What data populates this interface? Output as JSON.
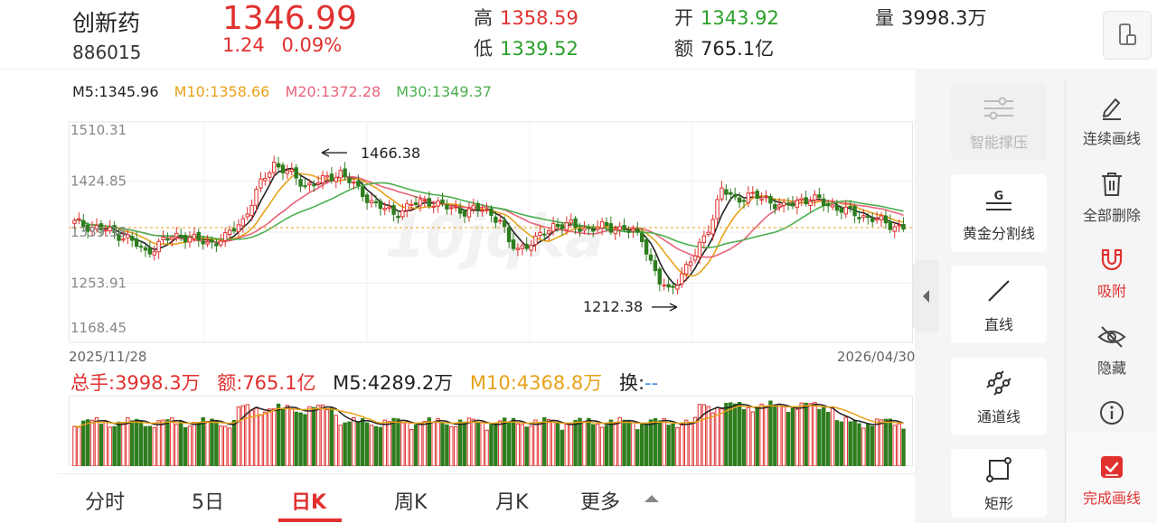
{
  "header": {
    "name": "创新药",
    "code": "886015",
    "price": "1346.99",
    "change": "1.24",
    "change_pct": "0.09%",
    "high_label": "高",
    "high": "1358.59",
    "low_label": "低",
    "low": "1339.52",
    "open_label": "开",
    "open": "1343.92",
    "amount_label": "额",
    "amount": "765.1亿",
    "volume_label": "量",
    "volume": "3998.3万"
  },
  "ma_legend": {
    "m5": "M5:1345.96",
    "m10": "M10:1358.66",
    "m20": "M20:1372.28",
    "m30": "M30:1349.37"
  },
  "volume_legend": {
    "total": "总手:3998.3万",
    "amount": "额:765.1亿",
    "m5": "M5:4289.2万",
    "m10": "M10:4368.8万",
    "turnover_label": "换:",
    "turnover_value": "--"
  },
  "chart_data": {
    "type": "candlestick",
    "y_ticks": [
      "1510.31",
      "1424.85",
      "1339.38",
      "1253.91",
      "1168.45"
    ],
    "ylim": [
      1168.45,
      1510.31
    ],
    "x_start": "2025/11/28",
    "x_end": "2026/04/30",
    "annotations": [
      {
        "text": "1466.38",
        "value": 1466.38
      },
      {
        "text": "1212.38",
        "value": 1212.38
      }
    ],
    "last_close": 1346.99,
    "colors": {
      "up": "#e0312f",
      "down": "#2e7d1e",
      "m5": "#222222",
      "m10": "#e8a21a",
      "m20": "#e8647a",
      "m30": "#4caf50"
    }
  },
  "tabs": [
    {
      "label": "分时",
      "active": false
    },
    {
      "label": "5日",
      "active": false
    },
    {
      "label": "日K",
      "active": true
    },
    {
      "label": "周K",
      "active": false
    },
    {
      "label": "月K",
      "active": false
    },
    {
      "label": "更多",
      "active": false
    }
  ],
  "tools": {
    "smart": "智能撑压",
    "golden": "黄金分割线",
    "line": "直线",
    "channel": "通道线",
    "rect": "矩形"
  },
  "side": {
    "continuous": "连续画线",
    "delete_all": "全部删除",
    "magnet": "吸附",
    "hide": "隐藏",
    "info_icon": "info-icon",
    "done": "完成画线"
  }
}
